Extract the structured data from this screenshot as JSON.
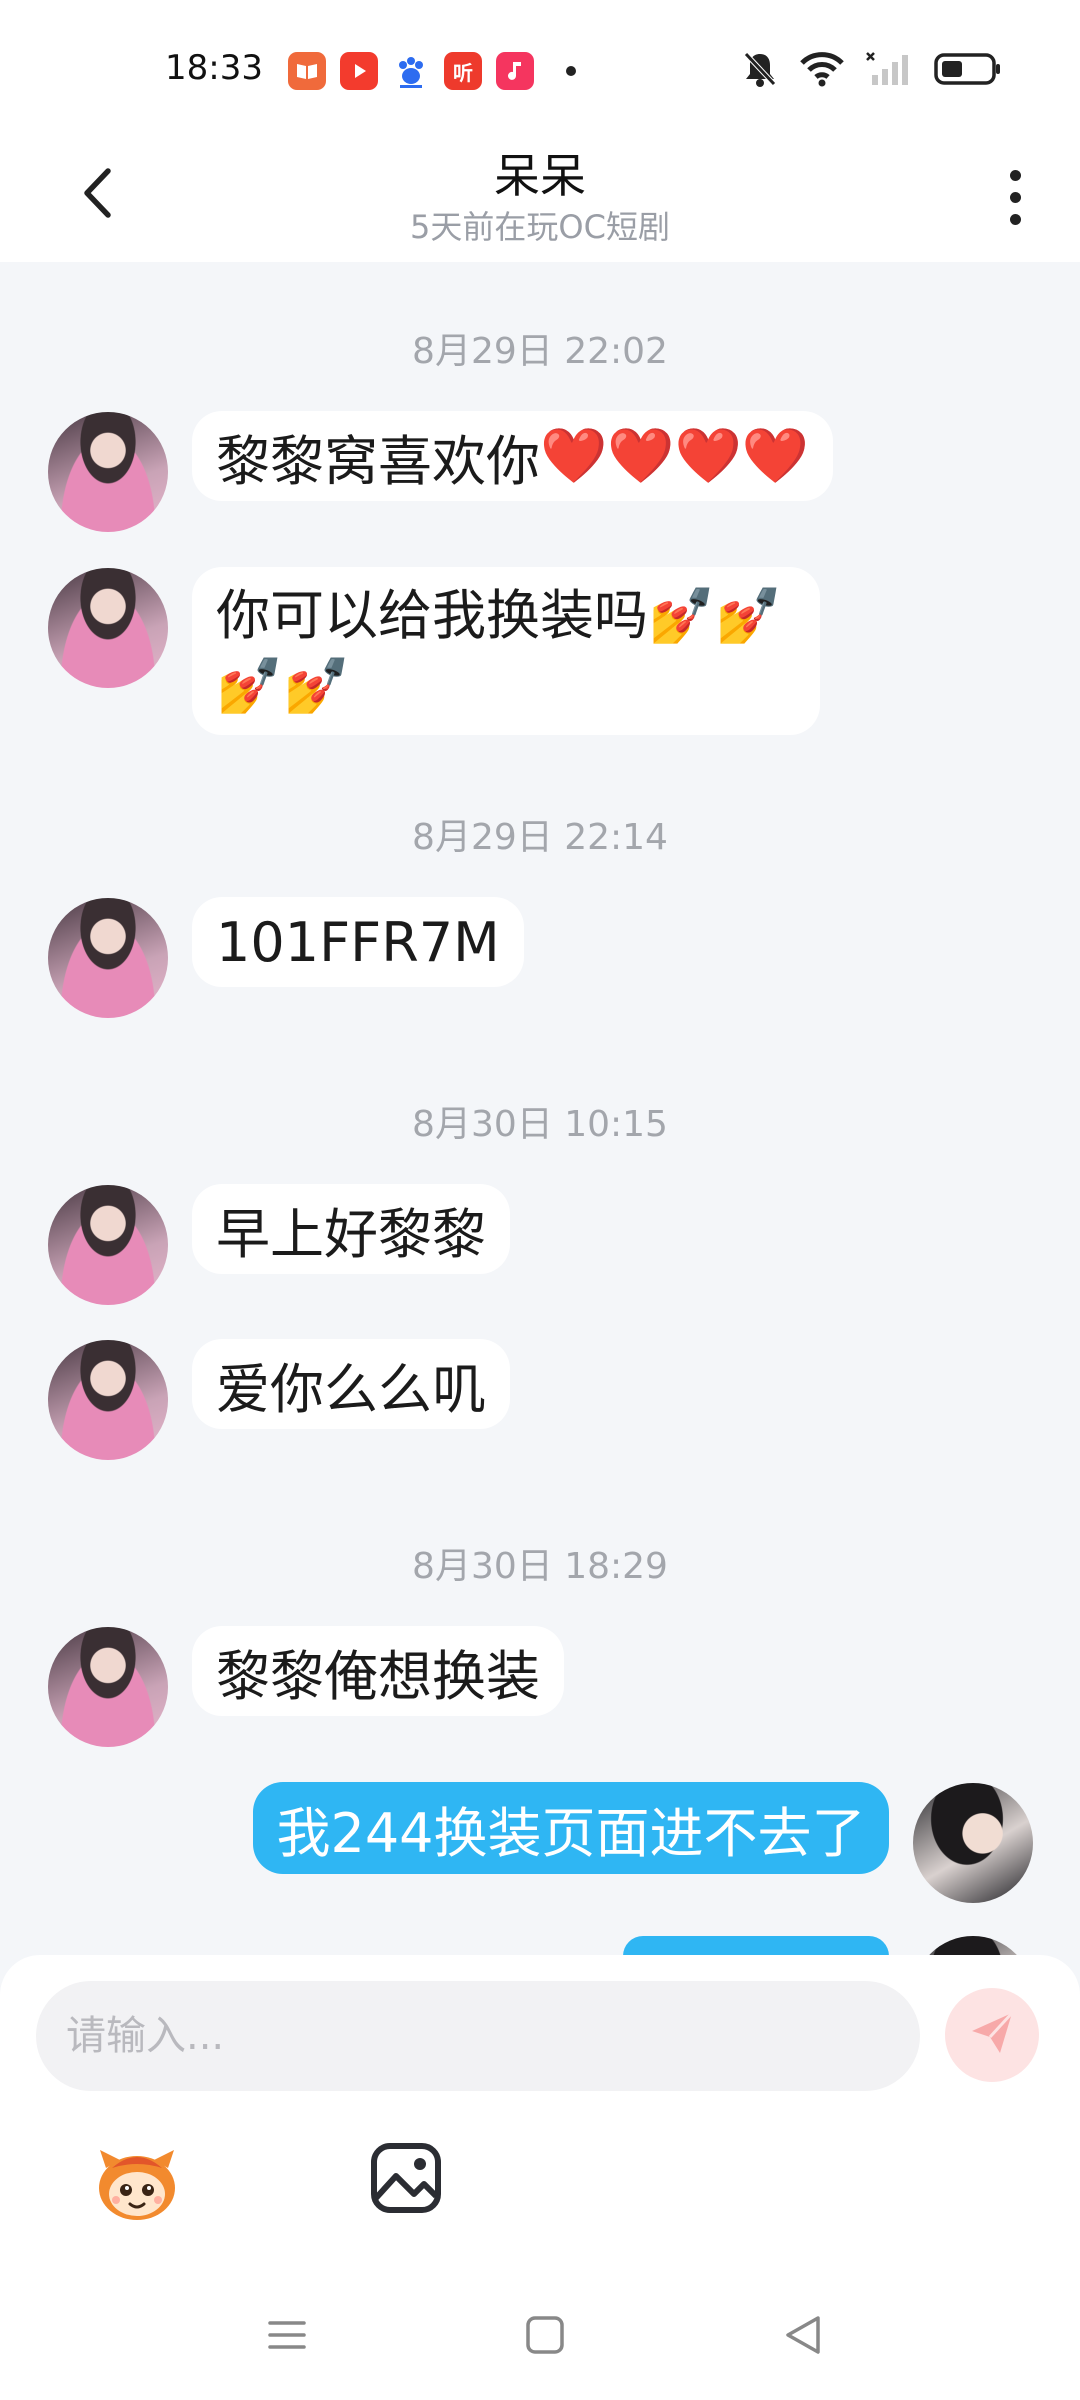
{
  "status_bar": {
    "time": "18:33",
    "app_icons": [
      "reader-app-icon",
      "video-app-icon",
      "baidu-app-icon",
      "listen-app-icon",
      "music-app-icon"
    ],
    "listen_label": "听",
    "right_icons": [
      "mute-icon",
      "wifi-icon",
      "signal-icon",
      "battery-icon"
    ]
  },
  "header": {
    "title": "呆呆",
    "subtitle": "5天前在玩OC短剧",
    "back_icon": "chevron-left-icon",
    "more_icon": "more-vertical-icon"
  },
  "messages": [
    {
      "type": "timestamp",
      "text": "8月29日 22:02"
    },
    {
      "type": "received",
      "text": "黎黎窝喜欢你",
      "emoji": "❤️❤️❤️❤️"
    },
    {
      "type": "received",
      "text": "你可以给我换装吗",
      "emoji": "💅💅💅💅"
    },
    {
      "type": "timestamp",
      "text": "8月29日 22:14"
    },
    {
      "type": "received",
      "text": "101FFR7M"
    },
    {
      "type": "timestamp",
      "text": "8月30日 10:15"
    },
    {
      "type": "received",
      "text": "早上好黎黎"
    },
    {
      "type": "received",
      "text": "爱你么么叽"
    },
    {
      "type": "timestamp",
      "text": "8月30日 18:29"
    },
    {
      "type": "received",
      "text": "黎黎俺想换装"
    },
    {
      "type": "sent",
      "text": "我244换装页面进不去了"
    }
  ],
  "composer": {
    "placeholder": "请输入...",
    "send_icon": "send-icon",
    "tools": [
      "sticker-icon",
      "image-icon"
    ]
  },
  "nav_bar": [
    "menu-icon",
    "home-icon",
    "back-icon"
  ],
  "colors": {
    "chat_background": "#f4f6f9",
    "sent_bubble": "#2fb6f3",
    "received_bubble": "#ffffff",
    "send_button": "#fde3e3",
    "send_icon": "#f7a9a9"
  }
}
